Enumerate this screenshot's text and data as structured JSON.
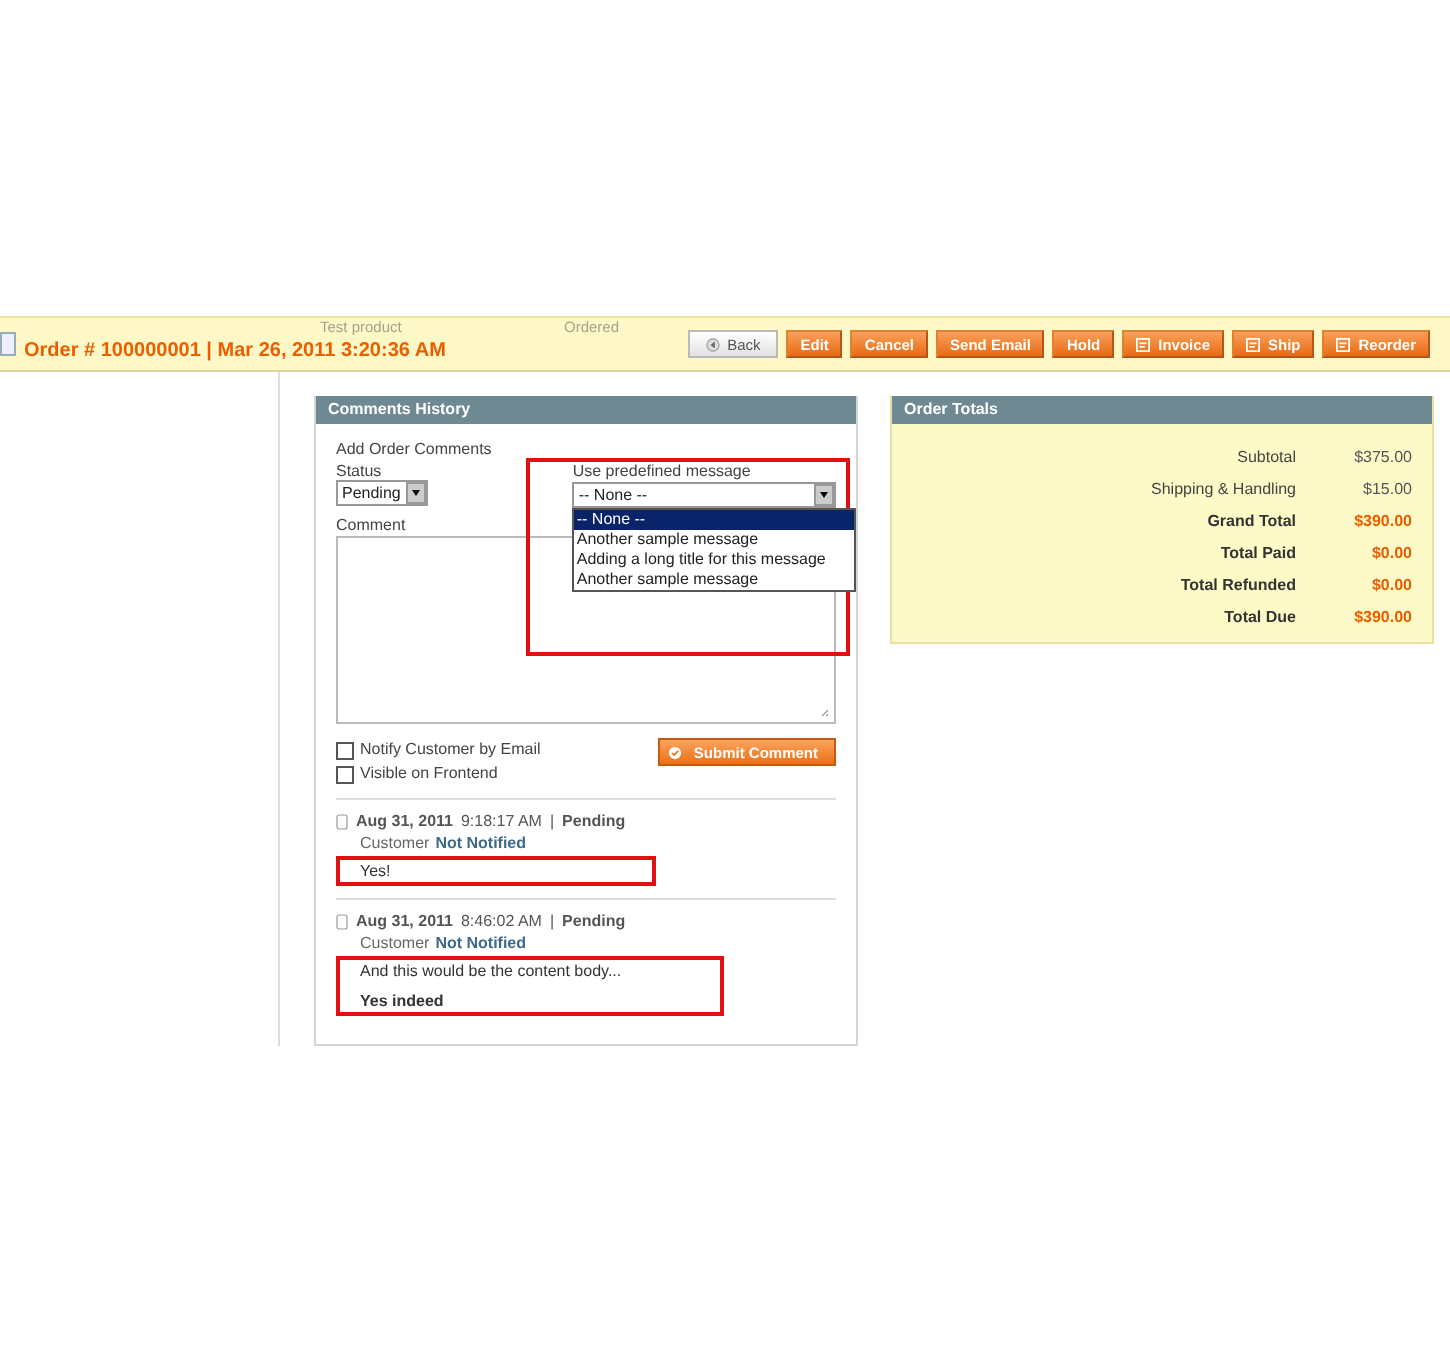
{
  "header": {
    "title": "Order # 100000001 | Mar 26, 2011 3:20:36 AM",
    "background_texts": [
      "Test product",
      "Ordered"
    ],
    "buttons": [
      {
        "label": "Back",
        "kind": "back"
      },
      {
        "label": "Edit",
        "kind": "plain"
      },
      {
        "label": "Cancel",
        "kind": "plain"
      },
      {
        "label": "Send Email",
        "kind": "plain"
      },
      {
        "label": "Hold",
        "kind": "plain"
      },
      {
        "label": "Invoice",
        "kind": "doc"
      },
      {
        "label": "Ship",
        "kind": "doc"
      },
      {
        "label": "Reorder",
        "kind": "doc"
      }
    ]
  },
  "comments": {
    "title": "Comments History",
    "add_title": "Add Order Comments",
    "status_label": "Status",
    "status_value": "Pending",
    "predefined_label": "Use predefined message",
    "predefined_value": "-- None --",
    "options": [
      {
        "label": "-- None --",
        "selected": true
      },
      {
        "label": "Another sample message",
        "selected": false
      },
      {
        "label": "Adding a long title for this message",
        "selected": false
      },
      {
        "label": "Another sample message",
        "selected": false
      }
    ],
    "comment_label": "Comment",
    "checkboxes": [
      {
        "label": "Notify Customer by Email",
        "checked": false
      },
      {
        "label": "Visible on Frontend",
        "checked": false
      }
    ],
    "submit": "Submit Comment",
    "entries": [
      {
        "date": "Aug 31, 2011",
        "time": "9:18:17 AM",
        "separator": "|",
        "status": "Pending",
        "customer": "Customer",
        "notified": "Not Notified",
        "lines": [
          {
            "text": "Yes!",
            "kind": "plain"
          }
        ]
      },
      {
        "date": "Aug 31, 2011",
        "time": "8:46:02 AM",
        "separator": "|",
        "status": "Pending",
        "customer": "Customer",
        "notified": "Not Notified",
        "lines": [
          {
            "text": "And this would be the content body...",
            "kind": "plain"
          },
          {
            "text": "Yes indeed",
            "kind": "bold"
          }
        ]
      }
    ]
  },
  "totals": {
    "title": "Order Totals",
    "rows": [
      {
        "label": "Subtotal",
        "value": "$375.00",
        "kind": "plain"
      },
      {
        "label": "Shipping & Handling",
        "value": "$15.00",
        "kind": "plain"
      },
      {
        "label": "Grand Total",
        "value": "$390.00",
        "kind": "strong"
      },
      {
        "label": "Total Paid",
        "value": "$0.00",
        "kind": "strong"
      },
      {
        "label": "Total Refunded",
        "value": "$0.00",
        "kind": "strong"
      },
      {
        "label": "Total Due",
        "value": "$390.00",
        "kind": "strong"
      }
    ]
  }
}
